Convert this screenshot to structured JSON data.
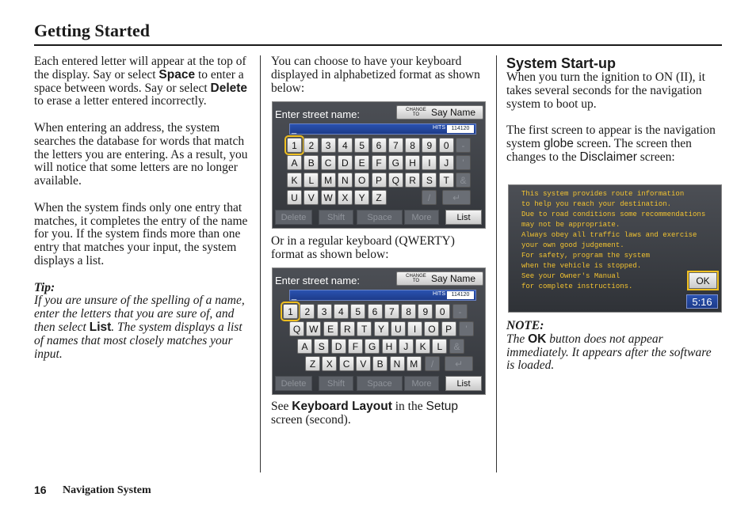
{
  "header": {
    "title": "Getting Started"
  },
  "footer": {
    "page_number": "16",
    "label": "Navigation System"
  },
  "col1": {
    "p1": {
      "t1": "Each entered letter will appear at the top of the display. Say or select ",
      "b1": "Space",
      "t2": " to enter a space between words. Say or select ",
      "b2": "Delete",
      "t3": " to erase a letter entered incorrectly."
    },
    "p2": "When entering an address, the system searches the database for words that match the letters you are entering. As a result, you will notice that some letters are no longer available.",
    "p3": "When the system finds only one entry that matches, it completes the entry of the name for you. If the system finds more than one entry that matches your input, the system displays a list.",
    "tip_label": "Tip:",
    "tip": {
      "t1": "If you are unsure of the spelling of a name, enter the letters that you are sure of, and then select ",
      "b1": "List",
      "t2": ". The system displays a list of names that most closely matches your input."
    }
  },
  "col2": {
    "p1": "You can choose to have your keyboard displayed in alphabetized format as shown below:",
    "p2": "Or in a regular keyboard (QWERTY) format as shown below:",
    "p3": {
      "t1": "See ",
      "b1": "Keyboard Layout",
      "t2": " in the ",
      "s1": "Setup",
      "t3": " screen (second)."
    }
  },
  "screen": {
    "label": "Enter street name:",
    "change_small": "CHANGE TO",
    "say_name": "Say Name",
    "cursor": "_",
    "hits_label": "HITS",
    "hits_count": "114120",
    "delete": "Delete",
    "shift": "Shift",
    "space": "Space",
    "more": "More",
    "list": "List",
    "backspace_icon": "↵",
    "slash": "/",
    "dash": "-",
    "apos": "'",
    "amp": "&"
  },
  "abc_rows": [
    [
      "1",
      "2",
      "3",
      "4",
      "5",
      "6",
      "7",
      "8",
      "9",
      "0"
    ],
    [
      "A",
      "B",
      "C",
      "D",
      "E",
      "F",
      "G",
      "H",
      "I",
      "J"
    ],
    [
      "K",
      "L",
      "M",
      "N",
      "O",
      "P",
      "Q",
      "R",
      "S",
      "T"
    ],
    [
      "U",
      "V",
      "W",
      "X",
      "Y",
      "Z"
    ]
  ],
  "qwerty_rows": [
    [
      "1",
      "2",
      "3",
      "4",
      "5",
      "6",
      "7",
      "8",
      "9",
      "0"
    ],
    [
      "Q",
      "W",
      "E",
      "R",
      "T",
      "Y",
      "U",
      "I",
      "O",
      "P"
    ],
    [
      "A",
      "S",
      "D",
      "F",
      "G",
      "H",
      "J",
      "K",
      "L"
    ],
    [
      "Z",
      "X",
      "C",
      "V",
      "B",
      "N",
      "M"
    ]
  ],
  "col3": {
    "heading": "System Start-up",
    "p1": "When you turn the ignition to ON (II), it takes several seconds for the navigation system to boot up.",
    "p2": {
      "t1": "The first screen to appear is the navigation system ",
      "s1": "globe",
      "t2": " screen. The screen then changes to the ",
      "s2": "Disclaimer",
      "t3": " screen:"
    },
    "note_label": "NOTE:",
    "note": {
      "t1": "The ",
      "b1": "OK",
      "t2": " button does not appear immediately. It appears after the software is loaded."
    }
  },
  "disclaimer": {
    "lines": [
      "This system provides route information",
      "to help you reach your destination.",
      "Due to road conditions some recommendations",
      "may not be appropriate.",
      "Always obey all traffic laws and exercise",
      "your own good judgement.",
      "For safety, program the system",
      "when the vehicle is stopped.",
      "See your Owner's Manual",
      "for complete instructions."
    ],
    "ok": "OK",
    "clock": "5:16"
  }
}
